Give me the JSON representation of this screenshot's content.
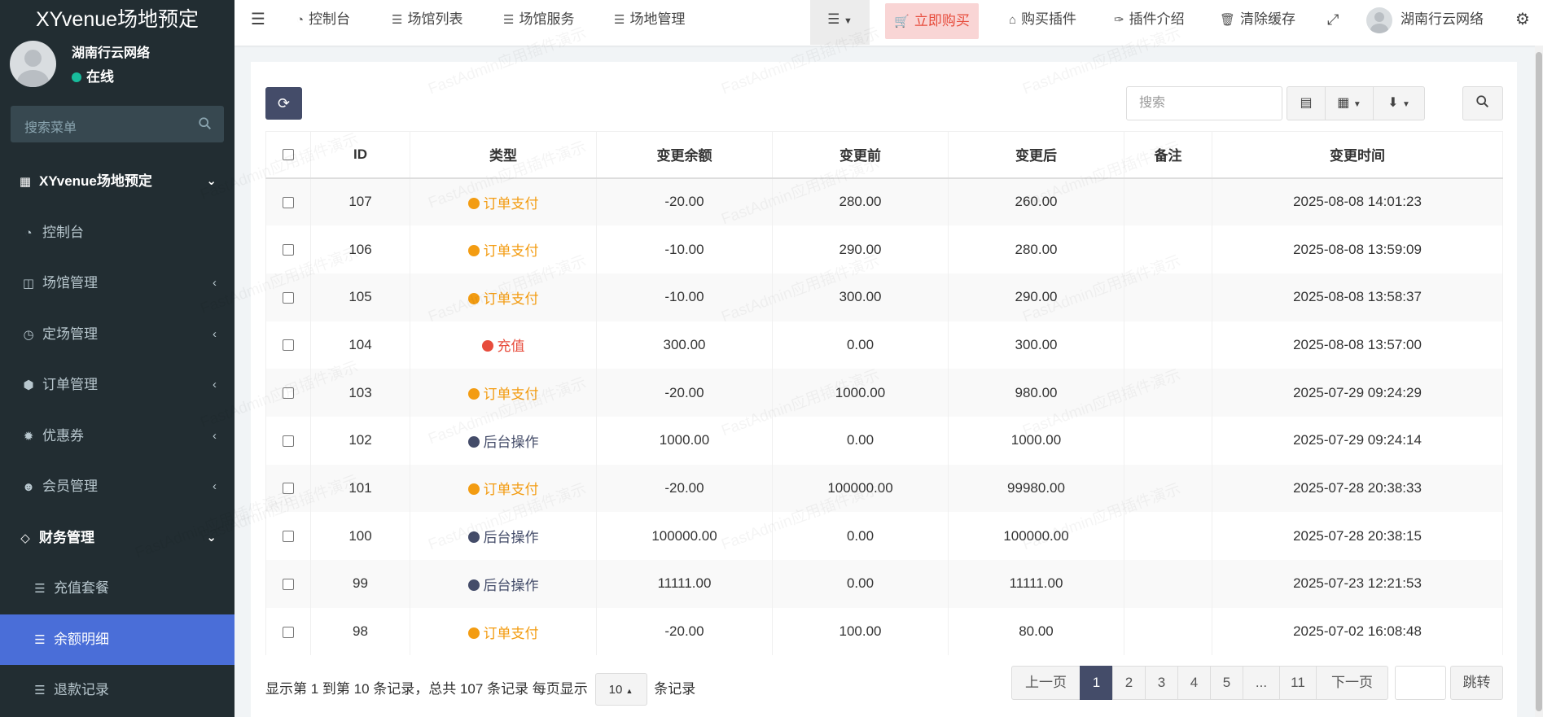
{
  "app": {
    "title": "XYvenue场地预定"
  },
  "user": {
    "name": "湖南行云网络",
    "status": "在线"
  },
  "sidebar": {
    "search_placeholder": "搜索菜单",
    "items": [
      {
        "label": "XYvenue场地预定",
        "icon": "grid-icon"
      },
      {
        "label": "控制台",
        "icon": "dashboard-icon"
      },
      {
        "label": "场馆管理",
        "icon": "columns-icon"
      },
      {
        "label": "定场管理",
        "icon": "clock-icon"
      },
      {
        "label": "订单管理",
        "icon": "cube-icon"
      },
      {
        "label": "优惠券",
        "icon": "ticket-icon"
      },
      {
        "label": "会员管理",
        "icon": "user-circle-icon"
      },
      {
        "label": "财务管理",
        "icon": "diamond-icon"
      },
      {
        "label": "充值套餐",
        "icon": "list-icon"
      },
      {
        "label": "余额明细",
        "icon": "list-icon"
      },
      {
        "label": "退款记录",
        "icon": "list-icon"
      }
    ]
  },
  "topbar": {
    "tabs": [
      "控制台",
      "场馆列表",
      "场馆服务",
      "场地管理"
    ],
    "buy_label": "立即购买",
    "buy_plugin": "购买插件",
    "plugin_intro": "插件介绍",
    "clear_cache": "清除缓存",
    "user_name": "湖南行云网络"
  },
  "toolbar": {
    "search_placeholder": "搜索"
  },
  "table": {
    "columns": [
      "ID",
      "类型",
      "变更余额",
      "变更前",
      "变更后",
      "备注",
      "变更时间"
    ],
    "rows": [
      {
        "id": "107",
        "type": "订单支付",
        "kind": "o",
        "change": "-20.00",
        "before": "280.00",
        "after": "260.00",
        "memo": "",
        "time": "2025-08-08 14:01:23"
      },
      {
        "id": "106",
        "type": "订单支付",
        "kind": "o",
        "change": "-10.00",
        "before": "290.00",
        "after": "280.00",
        "memo": "",
        "time": "2025-08-08 13:59:09"
      },
      {
        "id": "105",
        "type": "订单支付",
        "kind": "o",
        "change": "-10.00",
        "before": "300.00",
        "after": "290.00",
        "memo": "",
        "time": "2025-08-08 13:58:37"
      },
      {
        "id": "104",
        "type": "充值",
        "kind": "r",
        "change": "300.00",
        "before": "0.00",
        "after": "300.00",
        "memo": "",
        "time": "2025-08-08 13:57:00"
      },
      {
        "id": "103",
        "type": "订单支付",
        "kind": "o",
        "change": "-20.00",
        "before": "1000.00",
        "after": "980.00",
        "memo": "",
        "time": "2025-07-29 09:24:29"
      },
      {
        "id": "102",
        "type": "后台操作",
        "kind": "n",
        "change": "1000.00",
        "before": "0.00",
        "after": "1000.00",
        "memo": "",
        "time": "2025-07-29 09:24:14"
      },
      {
        "id": "101",
        "type": "订单支付",
        "kind": "o",
        "change": "-20.00",
        "before": "100000.00",
        "after": "99980.00",
        "memo": "",
        "time": "2025-07-28 20:38:33"
      },
      {
        "id": "100",
        "type": "后台操作",
        "kind": "n",
        "change": "100000.00",
        "before": "0.00",
        "after": "100000.00",
        "memo": "",
        "time": "2025-07-28 20:38:15"
      },
      {
        "id": "99",
        "type": "后台操作",
        "kind": "n",
        "change": "11111.00",
        "before": "0.00",
        "after": "11111.00",
        "memo": "",
        "time": "2025-07-23 12:21:53"
      },
      {
        "id": "98",
        "type": "订单支付",
        "kind": "o",
        "change": "-20.00",
        "before": "100.00",
        "after": "80.00",
        "memo": "",
        "time": "2025-07-02 16:08:48"
      }
    ]
  },
  "footer": {
    "info_prefix": "显示第 1 到第 10 条记录，总共 107 条记录 每页显示",
    "page_size": "10",
    "info_suffix": "条记录"
  },
  "pagination": {
    "prev": "上一页",
    "pages": [
      "1",
      "2",
      "3",
      "4",
      "5",
      "...",
      "11"
    ],
    "next": "下一页",
    "jump": "跳转",
    "current": "1"
  },
  "watermark": "FastAdmin应用插件演示"
}
